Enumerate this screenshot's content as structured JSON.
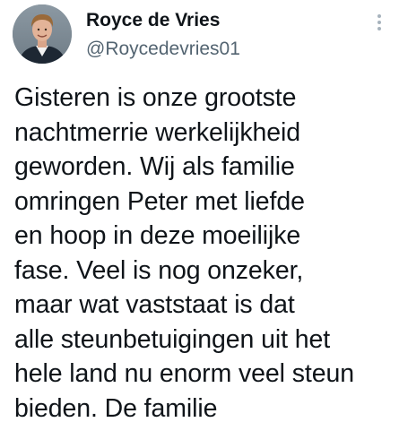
{
  "tweet": {
    "author": {
      "display_name": "Royce de Vries",
      "handle": "@Roycedevries01",
      "avatar_icon": "profile-photo"
    },
    "more_icon": "more-vertical-icon",
    "text_lines": [
      "Gisteren is onze grootste",
      "nachtmerrie werkelijkheid",
      "geworden. Wij als familie",
      "omringen Peter met liefde",
      "en hoop in deze moeilijke",
      "fase. Veel is nog onzeker,",
      "maar wat vaststaat is dat",
      "alle steunbetuigingen uit het",
      "hele land nu enorm veel steun",
      "bieden. De familie"
    ]
  },
  "colors": {
    "text": "#0f1419",
    "secondary": "#536471",
    "background": "#ffffff"
  }
}
